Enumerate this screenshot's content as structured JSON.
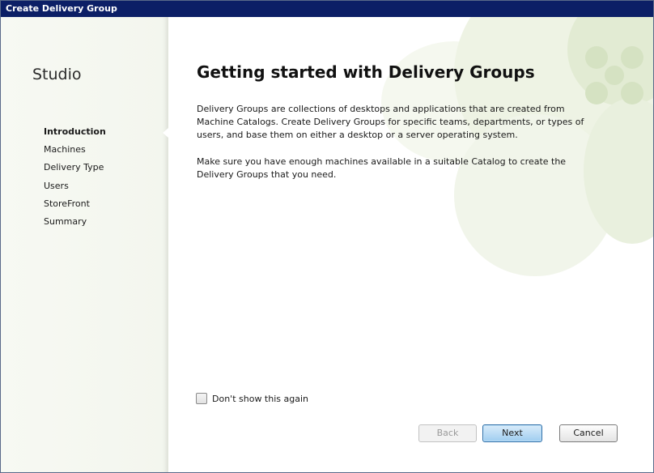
{
  "window": {
    "title": "Create Delivery Group"
  },
  "sidebar": {
    "title": "Studio",
    "items": [
      {
        "label": "Introduction",
        "active": true
      },
      {
        "label": "Machines",
        "active": false
      },
      {
        "label": "Delivery Type",
        "active": false
      },
      {
        "label": "Users",
        "active": false
      },
      {
        "label": "StoreFront",
        "active": false
      },
      {
        "label": "Summary",
        "active": false
      }
    ]
  },
  "main": {
    "heading": "Getting started with Delivery Groups",
    "paragraph1": "Delivery Groups are collections of desktops and applications that are created from Machine Catalogs. Create Delivery Groups for specific teams, departments, or types of users, and base them on either a desktop or a server operating system.",
    "paragraph2": "Make sure you have enough machines available in a suitable Catalog to create the Delivery Groups that you need.",
    "dont_show_label": "Don't show this again",
    "dont_show_checked": false
  },
  "buttons": {
    "back": "Back",
    "next": "Next",
    "cancel": "Cancel"
  },
  "colors": {
    "titlebar": "#0c1f66",
    "accent_green": "#e2ebd3",
    "next_button": "#9fcdf0"
  }
}
